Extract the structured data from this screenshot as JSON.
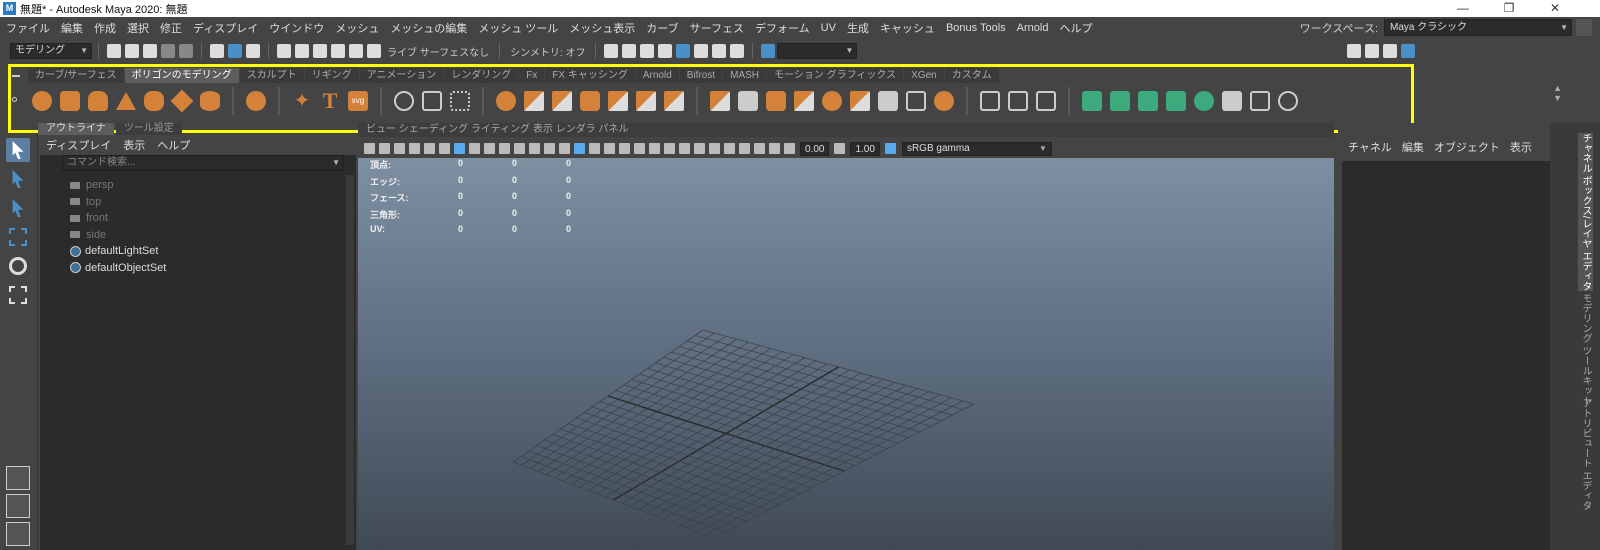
{
  "window": {
    "title": "無題* - Autodesk Maya 2020: 無題",
    "app_icon": "M",
    "minimize": "—",
    "maximize": "❐",
    "close": "✕"
  },
  "menubar": {
    "items": [
      "ファイル",
      "編集",
      "作成",
      "選択",
      "修正",
      "ディスプレイ",
      "ウインドウ",
      "メッシュ",
      "メッシュの編集",
      "メッシュ ツール",
      "メッシュ表示",
      "カーブ",
      "サーフェス",
      "デフォーム",
      "UV",
      "生成",
      "キャッシュ",
      "Bonus Tools",
      "Arnold",
      "ヘルプ"
    ]
  },
  "workspace": {
    "label": "ワークスペース:",
    "value": "Maya クラシック"
  },
  "statusline": {
    "menu_set": "モデリング",
    "live_surface": "ライブ サーフェスなし",
    "symmetry": "シンメトリ: オフ"
  },
  "shelf": {
    "tabs": [
      "カーブ/サーフェス",
      "ポリゴンのモデリング",
      "スカルプト",
      "リギング",
      "アニメーション",
      "レンダリング",
      "Fx",
      "FX キャッシング",
      "Arnold",
      "Bifrost",
      "MASH",
      "モーション グラフィックス",
      "XGen",
      "カスタム"
    ],
    "active_tab": "ポリゴンのモデリング",
    "text_icon": "T",
    "svg_icon": "svg",
    "scroll_up": "▲",
    "scroll_down": "▼"
  },
  "outliner": {
    "tabs": [
      "アウトライナ",
      "ツール設定"
    ],
    "menus": [
      "ディスプレイ",
      "表示",
      "ヘルプ"
    ],
    "search_placeholder": "コマンド検索...",
    "items": [
      {
        "label": "persp",
        "type": "camera"
      },
      {
        "label": "top",
        "type": "camera"
      },
      {
        "label": "front",
        "type": "camera"
      },
      {
        "label": "side",
        "type": "camera"
      },
      {
        "label": "defaultLightSet",
        "type": "set"
      },
      {
        "label": "defaultObjectSet",
        "type": "set"
      }
    ]
  },
  "viewport": {
    "menu": "ビュー  シェーディング  ライティング  表示  レンダラ  パネル",
    "exposure": "0.00",
    "gamma": "1.00",
    "color_space": "sRGB gamma",
    "hud": [
      {
        "label": "頂点:",
        "values": [
          "0",
          "0",
          "0"
        ]
      },
      {
        "label": "エッジ:",
        "values": [
          "0",
          "0",
          "0"
        ]
      },
      {
        "label": "フェース:",
        "values": [
          "0",
          "0",
          "0"
        ]
      },
      {
        "label": "三角形:",
        "values": [
          "0",
          "0",
          "0"
        ]
      },
      {
        "label": "UV:",
        "values": [
          "0",
          "0",
          "0"
        ]
      }
    ]
  },
  "channelbox": {
    "menus": [
      "チャネル",
      "編集",
      "オブジェクト",
      "表示"
    ]
  },
  "sidetabs": [
    "チャネル ボックス/レイヤ エディタ",
    "モデリング ツールキット",
    "アトリビュート エディタ"
  ]
}
